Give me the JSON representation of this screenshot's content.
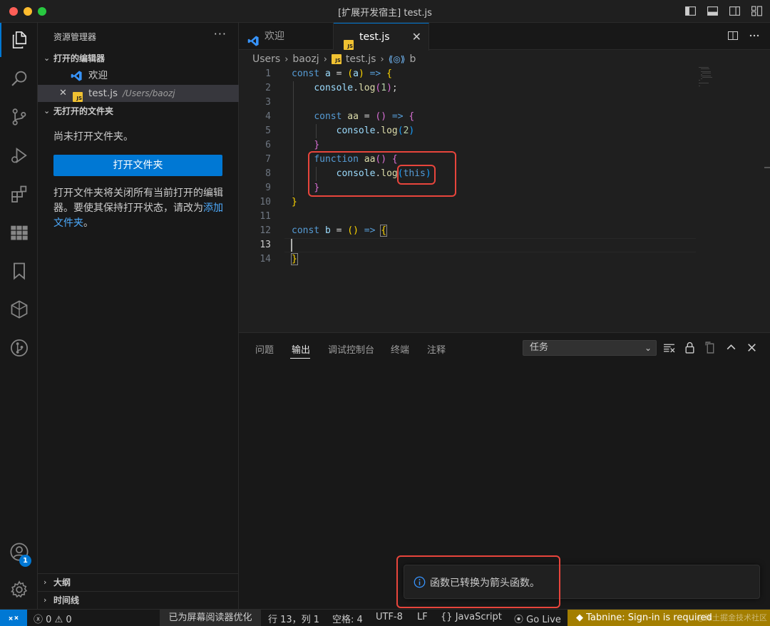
{
  "window": {
    "title": "[扩展开发宿主] test.js"
  },
  "sidebar": {
    "header": "资源管理器",
    "more": "···",
    "open_editors": {
      "title": "打开的编辑器",
      "items": [
        {
          "label": "欢迎",
          "path": "",
          "icon": "vscode-icon"
        },
        {
          "label": "test.js",
          "path": "/Users/baozj",
          "icon": "js-file-icon",
          "badge": "JS"
        }
      ]
    },
    "no_folder": {
      "title": "无打开的文件夹",
      "message": "尚未打开文件夹。",
      "button": "打开文件夹",
      "hint_text": "打开文件夹将关闭所有当前打开的编辑器。要使其保持打开状态，请改为",
      "hint_link": "添加文件夹",
      "hint_end": "。"
    },
    "outline": "大纲",
    "timeline": "时间线"
  },
  "activity_bar": {
    "accounts_badge": "1",
    "items": [
      "explorer-icon",
      "search-icon",
      "source-control-icon",
      "run-debug-icon",
      "extensions-icon",
      "grid-icon",
      "bookmark-icon",
      "box-icon",
      "git-graph-icon",
      "account-icon",
      "gear-icon"
    ]
  },
  "tabs": [
    {
      "label": "欢迎",
      "active": false
    },
    {
      "label": "test.js",
      "active": true,
      "badge": "JS"
    }
  ],
  "breadcrumb": {
    "parts": [
      "Users",
      "baozj",
      "test.js",
      "b"
    ],
    "js_badge": "JS"
  },
  "editor": {
    "current_line": 13,
    "lines": [
      "1",
      "2",
      "3",
      "4",
      "5",
      "6",
      "7",
      "8",
      "9",
      "10",
      "11",
      "12",
      "13",
      "14"
    ]
  },
  "panel": {
    "tabs": [
      "问题",
      "输出",
      "调试控制台",
      "终端",
      "注释"
    ],
    "active_tab": "输出",
    "select_value": "任务"
  },
  "notification": {
    "message": "函数已转换为箭头函数。"
  },
  "status_bar": {
    "errors": "0",
    "warnings": "0",
    "screen_reader": "已为屏幕阅读器优化",
    "position": "行 13，列 1",
    "spaces": "空格: 4",
    "encoding": "UTF-8",
    "eol": "LF",
    "language": "JavaScript",
    "go_live": "Go Live",
    "tabnine": "Tabnine: Sign-in is required"
  },
  "watermark": "@稀土掘金技术社区",
  "colors": {
    "accent": "#0078d4",
    "highlight_box": "#e8453c",
    "tabnine_bg": "#a37e00",
    "js_badge": "#f1c232"
  }
}
